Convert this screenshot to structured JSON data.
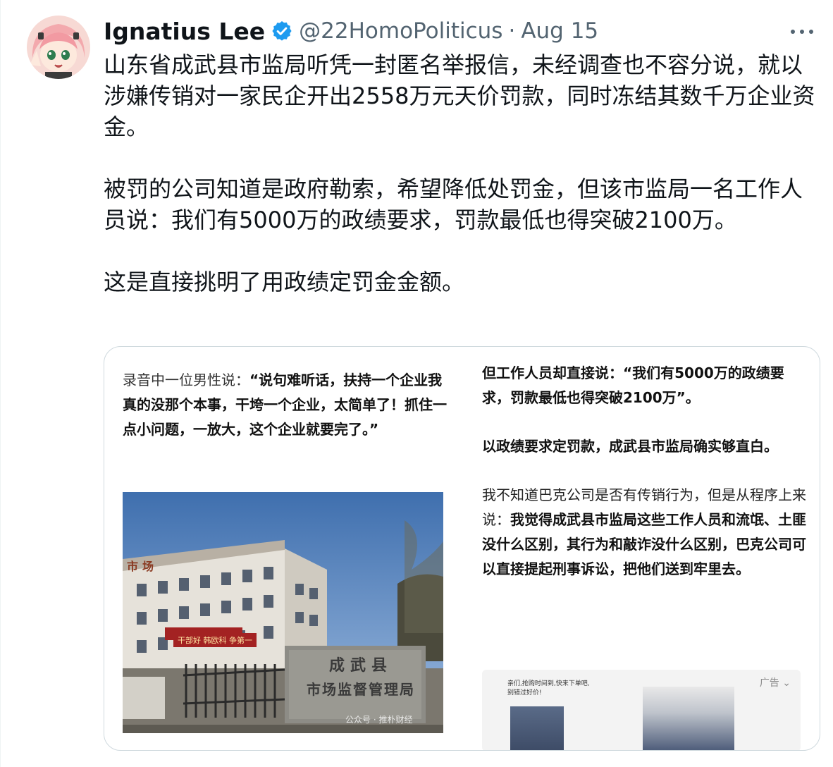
{
  "tweet": {
    "author_name": "Ignatius Lee",
    "handle": "@22HomoPoliticus",
    "separator": "·",
    "date": "Aug 15",
    "paragraphs": [
      "山东省成武县市监局听凭一封匿名举报信，未经调查也不容分说，就以涉嫌传销对一家民企开出2558万元天价罚款，同时冻结其数千万企业资金。",
      "被罚的公司知道是政府勒索，希望降低处罚金，但该市监局一名工作人员说：我们有5000万的政绩要求，罚款最低也得突破2100万。",
      "这是直接挑明了用政绩定罚金金额。"
    ]
  },
  "media": {
    "left_quote_lead": "录音中一位男性说：",
    "left_quote_bold": "“说句难听话，扶持一个企业我真的没那个本事，干垮一个企业，太简单了！抓住一点小问题，一放大，这个企业就要完了。”",
    "right_p1": "但工作人员却直接说：“我们有5000万的政绩要求，罚款最低也得突破2100万”。",
    "right_p2": "以政绩要求定罚款，成武县市监局确实够直白。",
    "right_p3_lead": "我不知道巴克公司是否有传销行为，但是从程序上来说：",
    "right_p3_bold": "我觉得成武县市监局这些工作人员和流氓、土匪没什么区别，其行为和敲诈没什么区别，巴克公司可以直接提起刑事诉讼，把他们送到牢里去。",
    "photo": {
      "sign_line1": "成武县",
      "sign_line2": "市场监督管理局",
      "roof_text": "市场",
      "banner_text": "干部好  韩欧科  争第一",
      "watermark": "公众号 · 推朴财经"
    },
    "ad": {
      "label": "广告 ⌄",
      "chat_text": "亲们,抢购时间到,快来下单吧,别错过好价!"
    }
  },
  "colors": {
    "verified_blue": "#1d9bf0",
    "text_primary": "#0f1419",
    "text_secondary": "#536471",
    "border": "#cfd9de"
  },
  "icons": {
    "verified": "verified-badge-icon",
    "more": "more-horizontal-icon"
  }
}
